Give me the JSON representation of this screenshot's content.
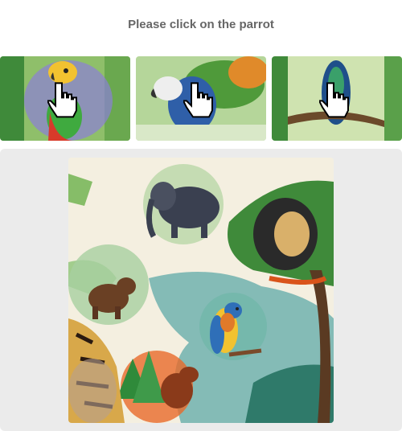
{
  "prompt": "Please click on the parrot",
  "thumbnails": [
    {
      "icon": "parrot-thumbnail",
      "cursor": "hand-pointer-icon"
    },
    {
      "icon": "bird-in-leaves-thumbnail",
      "cursor": "hand-pointer-icon"
    },
    {
      "icon": "bird-on-branch-thumbnail",
      "cursor": "hand-pointer-icon"
    }
  ],
  "scene": {
    "animals": [
      "elephant",
      "lion",
      "bear",
      "parrot",
      "squirrel",
      "tiger"
    ]
  },
  "colors": {
    "panel": "#ebebeb",
    "prompt_text": "#666666"
  }
}
